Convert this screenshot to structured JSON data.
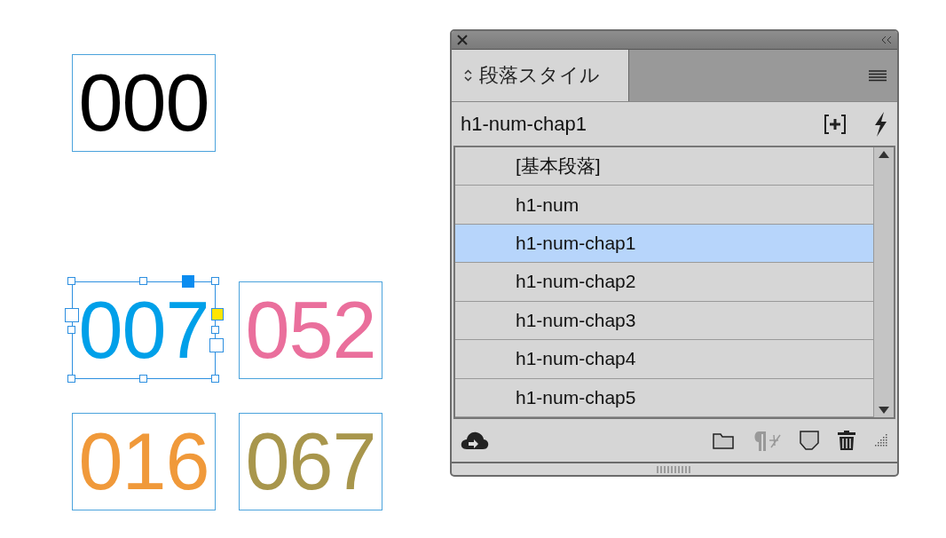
{
  "canvas": {
    "frames": [
      {
        "text": "000",
        "color": "#000000",
        "selected": false
      },
      {
        "text": "007",
        "color": "#00a0e9",
        "selected": true
      },
      {
        "text": "052",
        "color": "#ea6f9c",
        "selected": false
      },
      {
        "text": "016",
        "color": "#f0993a",
        "selected": false
      },
      {
        "text": "067",
        "color": "#a8964c",
        "selected": false
      }
    ]
  },
  "panel": {
    "tab": {
      "label": "段落スタイル",
      "selected": true
    },
    "current_style": "h1-num-chap1",
    "styles": [
      {
        "label": "[基本段落]",
        "selected": false
      },
      {
        "label": "h1-num",
        "selected": false
      },
      {
        "label": "h1-num-chap1",
        "selected": true
      },
      {
        "label": "h1-num-chap2",
        "selected": false
      },
      {
        "label": "h1-num-chap3",
        "selected": false
      },
      {
        "label": "h1-num-chap4",
        "selected": false
      },
      {
        "label": "h1-num-chap5",
        "selected": false
      }
    ]
  }
}
